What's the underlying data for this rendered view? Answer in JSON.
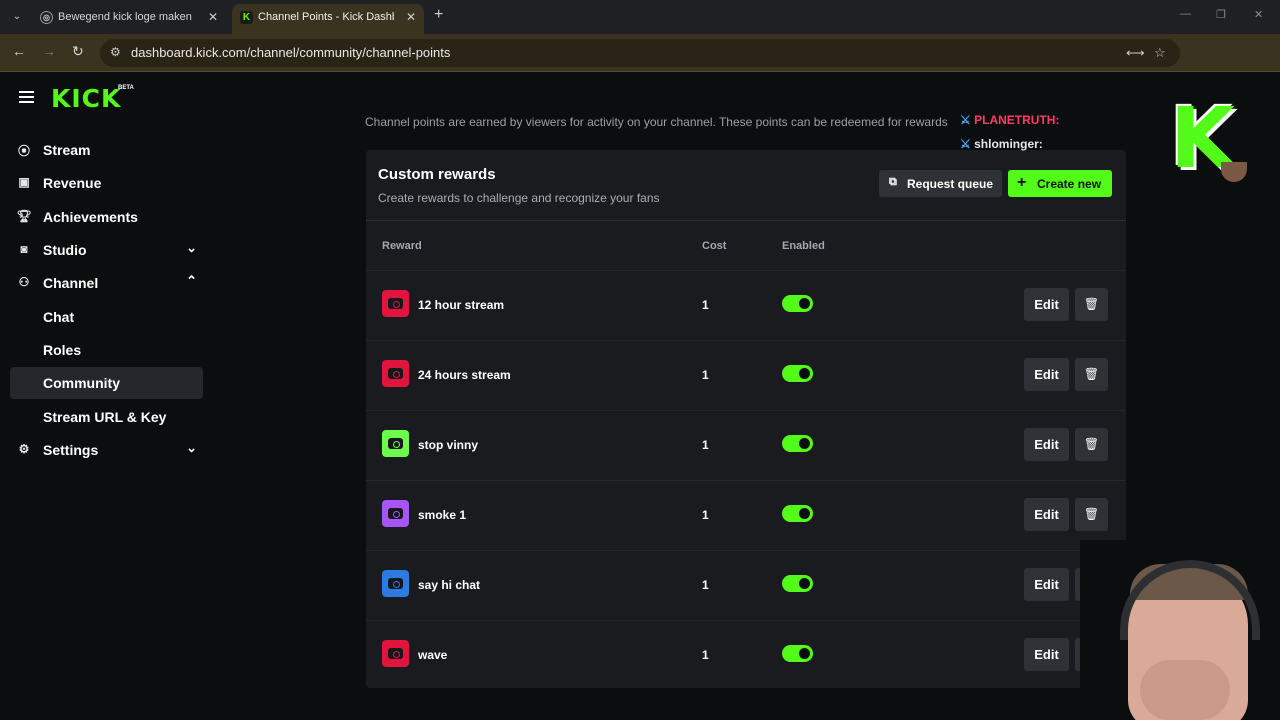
{
  "browser": {
    "tabs": [
      {
        "title": "Bewegend kick loge maken",
        "active": false
      },
      {
        "title": "Channel Points - Kick Dashboard",
        "active": true
      }
    ],
    "url": "dashboard.kick.com/channel/community/channel-points"
  },
  "app": {
    "logo": "KICK",
    "beta": "BETA"
  },
  "sidebar": {
    "items": [
      {
        "label": "Stream",
        "icon": "broadcast-icon"
      },
      {
        "label": "Revenue",
        "icon": "chart-icon"
      },
      {
        "label": "Achievements",
        "icon": "trophy-icon"
      },
      {
        "label": "Studio",
        "icon": "studio-icon",
        "expanded": false
      },
      {
        "label": "Channel",
        "icon": "channel-icon",
        "expanded": true
      },
      {
        "label": "Chat"
      },
      {
        "label": "Roles"
      },
      {
        "label": "Community",
        "selected": true
      },
      {
        "label": "Stream URL & Key"
      },
      {
        "label": "Settings",
        "icon": "gear-icon",
        "expanded": false
      }
    ]
  },
  "main": {
    "intro": "Channel points are earned by viewers for activity on your channel. These points can be redeemed for rewards",
    "card": {
      "title": "Custom rewards",
      "subtitle": "Create rewards to challenge and recognize your fans",
      "request_queue": "Request queue",
      "create_new": "Create new",
      "columns": {
        "reward": "Reward",
        "cost": "Cost",
        "enabled": "Enabled"
      },
      "edit_label": "Edit",
      "rows": [
        {
          "name": "12 hour stream",
          "cost": "1",
          "enabled": true,
          "color": "#e0143c"
        },
        {
          "name": "24 hours stream",
          "cost": "1",
          "enabled": true,
          "color": "#e0143c"
        },
        {
          "name": "stop vinny",
          "cost": "1",
          "enabled": true,
          "color": "#6efc4c"
        },
        {
          "name": "smoke 1",
          "cost": "1",
          "enabled": true,
          "color": "#a855f7"
        },
        {
          "name": "say hi chat",
          "cost": "1",
          "enabled": true,
          "color": "#2b7be0"
        },
        {
          "name": "wave",
          "cost": "1",
          "enabled": true,
          "color": "#e0143c"
        }
      ]
    }
  },
  "overlay": {
    "logo_letter": "K",
    "chat": [
      {
        "user": "PLANETRUTH:",
        "color": "#ff3b6b"
      },
      {
        "user": "shlominger:",
        "color": "#e6e6e6"
      }
    ]
  },
  "colors": {
    "accent": "#53fc18",
    "background": "#0b0e0f",
    "card": "#191b1f"
  }
}
